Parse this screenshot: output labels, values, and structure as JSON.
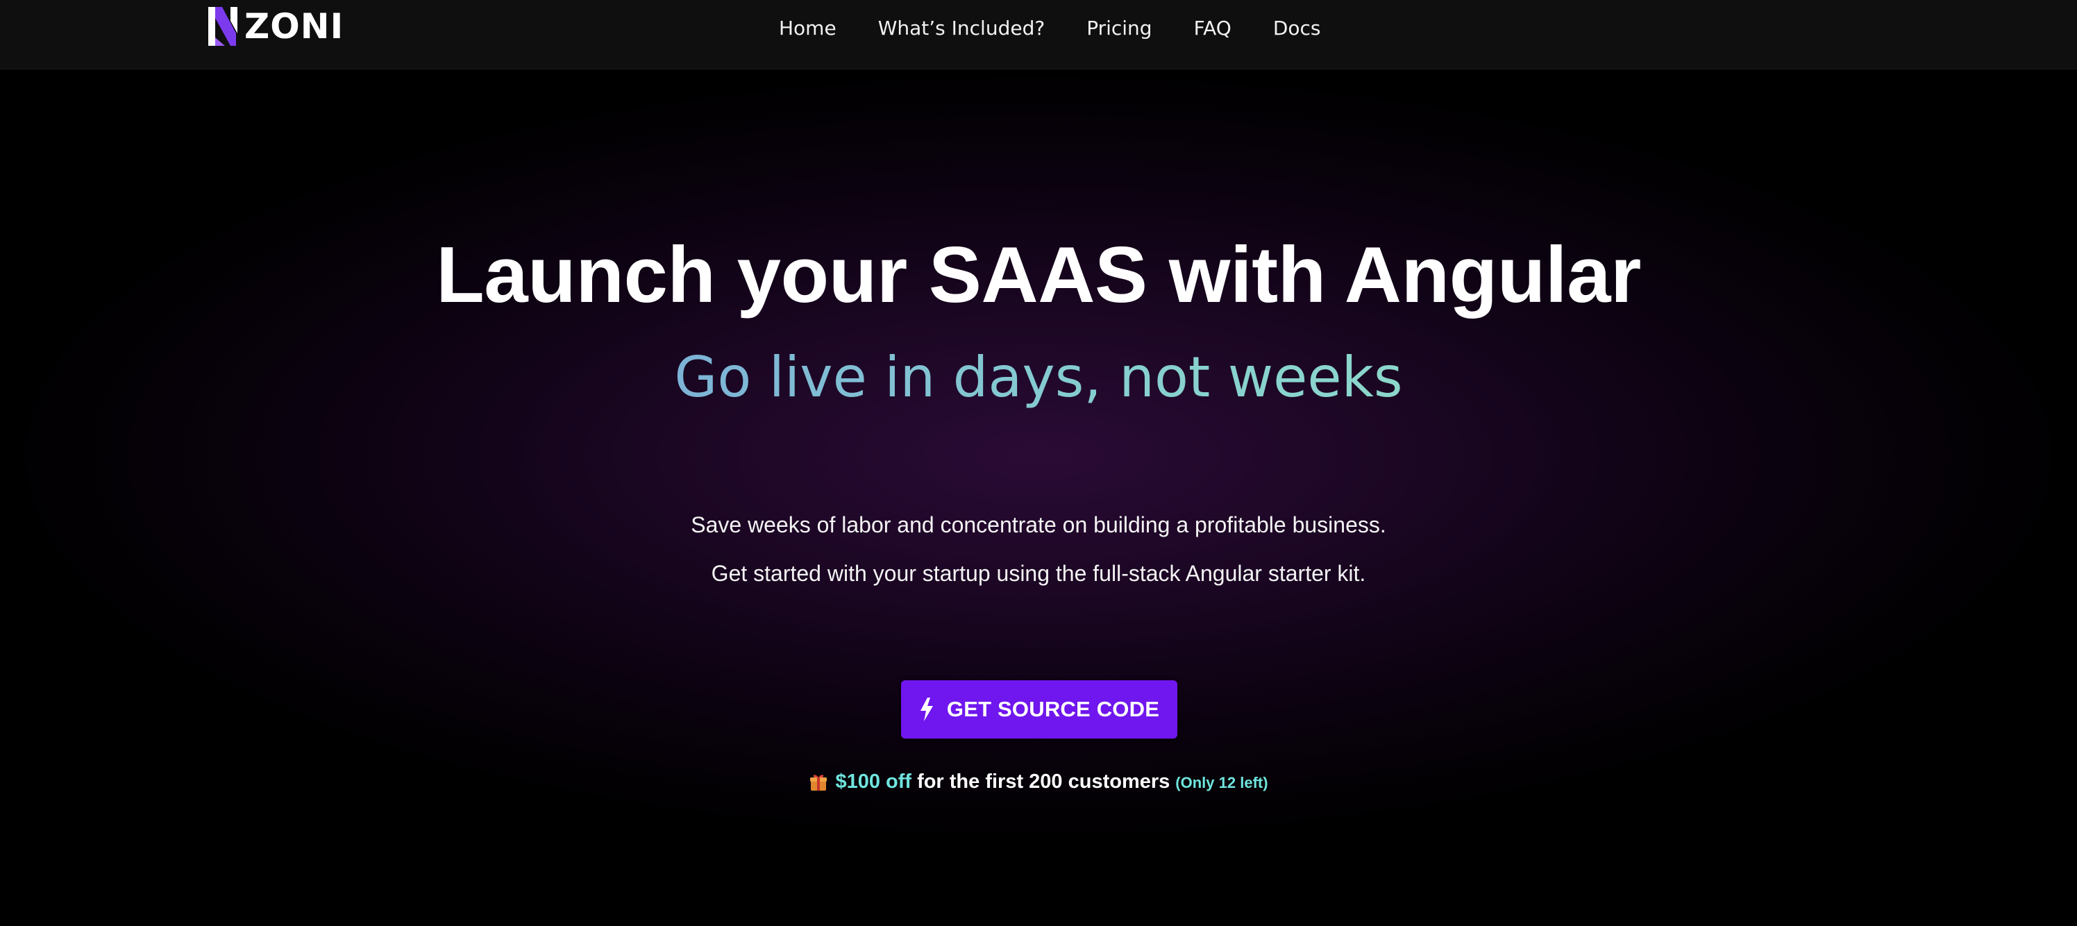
{
  "brand": {
    "name": "ZONI",
    "accent": "#7c3aed"
  },
  "nav": {
    "items": [
      {
        "label": "Home"
      },
      {
        "label": "What’s Included?"
      },
      {
        "label": "Pricing"
      },
      {
        "label": "FAQ"
      },
      {
        "label": "Docs"
      }
    ]
  },
  "hero": {
    "title": "Launch your SAAS with Angular",
    "subtitle": "Go live in days, not weeks",
    "line1": "Save weeks of labor and concentrate on building a profitable business.",
    "line2": "Get started with your startup using the full-stack Angular starter kit.",
    "cta": {
      "label": "GET SOURCE CODE",
      "icon": "lightning-bolt-icon",
      "color": "#7016ee"
    },
    "promo": {
      "icon": "gift-icon",
      "amount": "$100 off",
      "text": "for the first 200 customers",
      "remaining": "(Only 12 left)",
      "highlight_color": "#70e5de"
    }
  },
  "colors": {
    "navbar_bg": "#0f0f10",
    "hero_glow": "#2a0b35",
    "subtitle_gradient_start": "#7db3d6",
    "subtitle_gradient_end": "#8cd7cc"
  }
}
